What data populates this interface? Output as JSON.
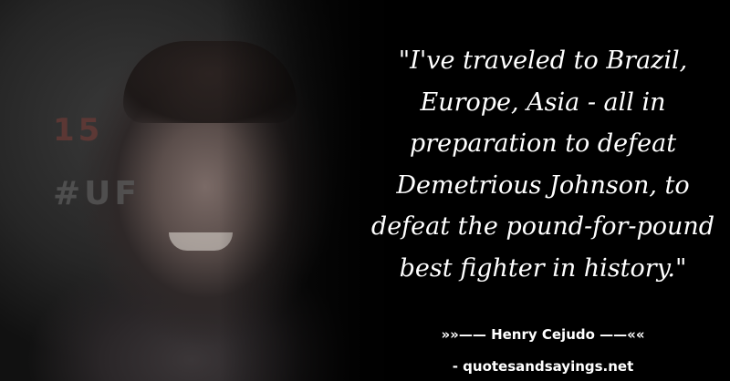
{
  "photo": {
    "backdrop_number": "15",
    "backdrop_hashtag": "#UF"
  },
  "quote": {
    "lines": [
      "\"I've traveled to Brazil,",
      "Europe, Asia - all in",
      "preparation to defeat",
      "Demetrious Johnson, to",
      "defeat the pound-for-pound",
      "best fighter in history.\""
    ]
  },
  "attribution": "»»—— Henry Cejudo ——««",
  "website": "- quotesandsayings.net",
  "colors": {
    "background": "#000000",
    "text": "#ffffff"
  }
}
